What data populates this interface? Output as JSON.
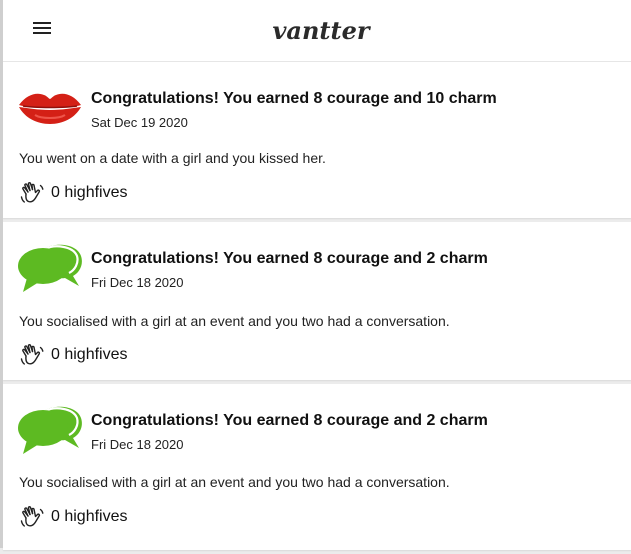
{
  "header": {
    "menu_icon": "hamburger-menu-icon",
    "logo_text": "vantter"
  },
  "posts": [
    {
      "icon": "lips-icon",
      "title": "Congratulations! You earned 8 courage and 10 charm",
      "date": "Sat Dec 19 2020",
      "text": "You went on a date with a girl and you kissed her.",
      "highfives": "0 highfives"
    },
    {
      "icon": "speech-bubbles-icon",
      "title": "Congratulations! You earned 8 courage and 2 charm",
      "date": "Fri Dec 18 2020",
      "text": "You socialised with a girl at an event and you two had a conversation.",
      "highfives": "0 highfives"
    },
    {
      "icon": "speech-bubbles-icon",
      "title": "Congratulations! You earned 8 courage and 2 charm",
      "date": "Fri Dec 18 2020",
      "text": "You socialised with a girl at an event and you two had a conversation.",
      "highfives": "0 highfives"
    }
  ],
  "colors": {
    "lips": "#d42016",
    "bubbles": "#5dba22",
    "background": "#ececec",
    "card": "#ffffff"
  }
}
